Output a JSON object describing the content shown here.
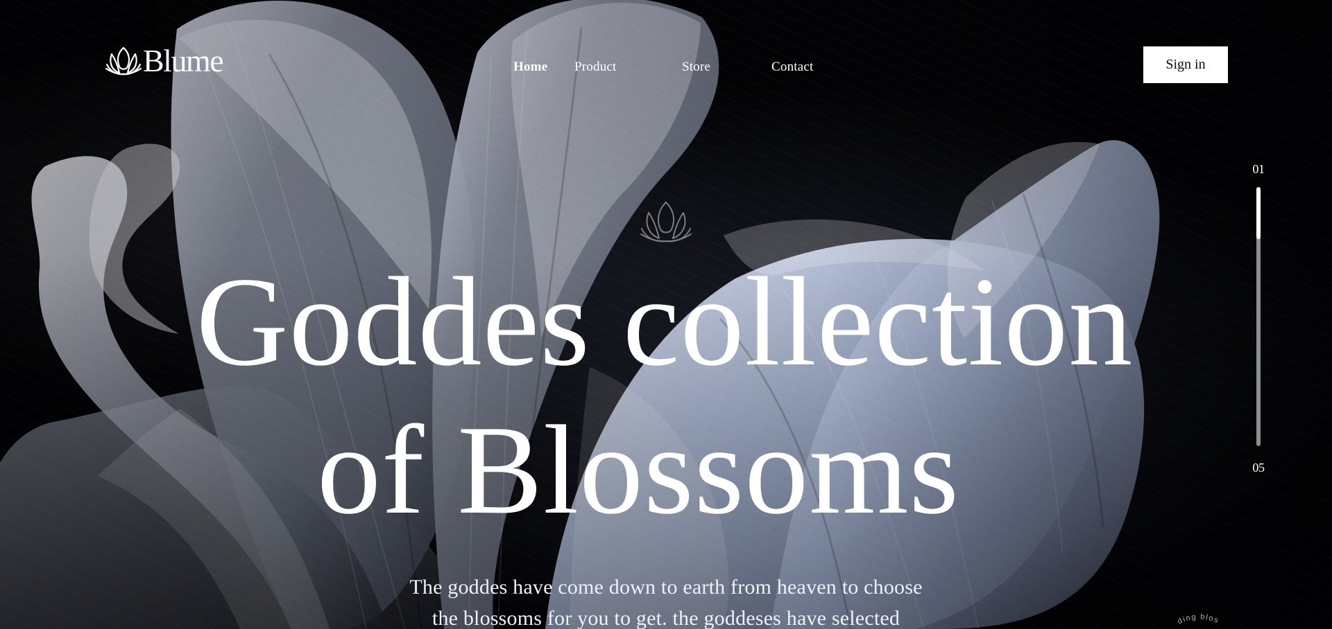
{
  "brand": {
    "name": "Blume",
    "icon": "lotus-icon"
  },
  "nav": {
    "items": [
      {
        "label": "Home",
        "active": true
      },
      {
        "label": "Product",
        "active": false
      },
      {
        "label": "Store",
        "active": false
      },
      {
        "label": "Contact",
        "active": false
      }
    ]
  },
  "header": {
    "sign_in_label": "Sign in"
  },
  "scroll": {
    "start_label": "01",
    "end_label": "05",
    "progress": 0.2
  },
  "hero": {
    "decorative_icon": "lotus-icon",
    "title_line_1": "Goddes collection",
    "title_line_2": "of Blossoms",
    "subtitle_line_1": "The goddes have come down to earth from heaven to choose",
    "subtitle_line_2": "the blossoms for you to get. the goddeses have selected",
    "curved_text": "ding blos"
  },
  "colors": {
    "background": "#040407",
    "text": "#ffffff",
    "button_bg": "#ffffff",
    "button_text": "#0b0b10",
    "scroll_track": "#8e8e90"
  }
}
